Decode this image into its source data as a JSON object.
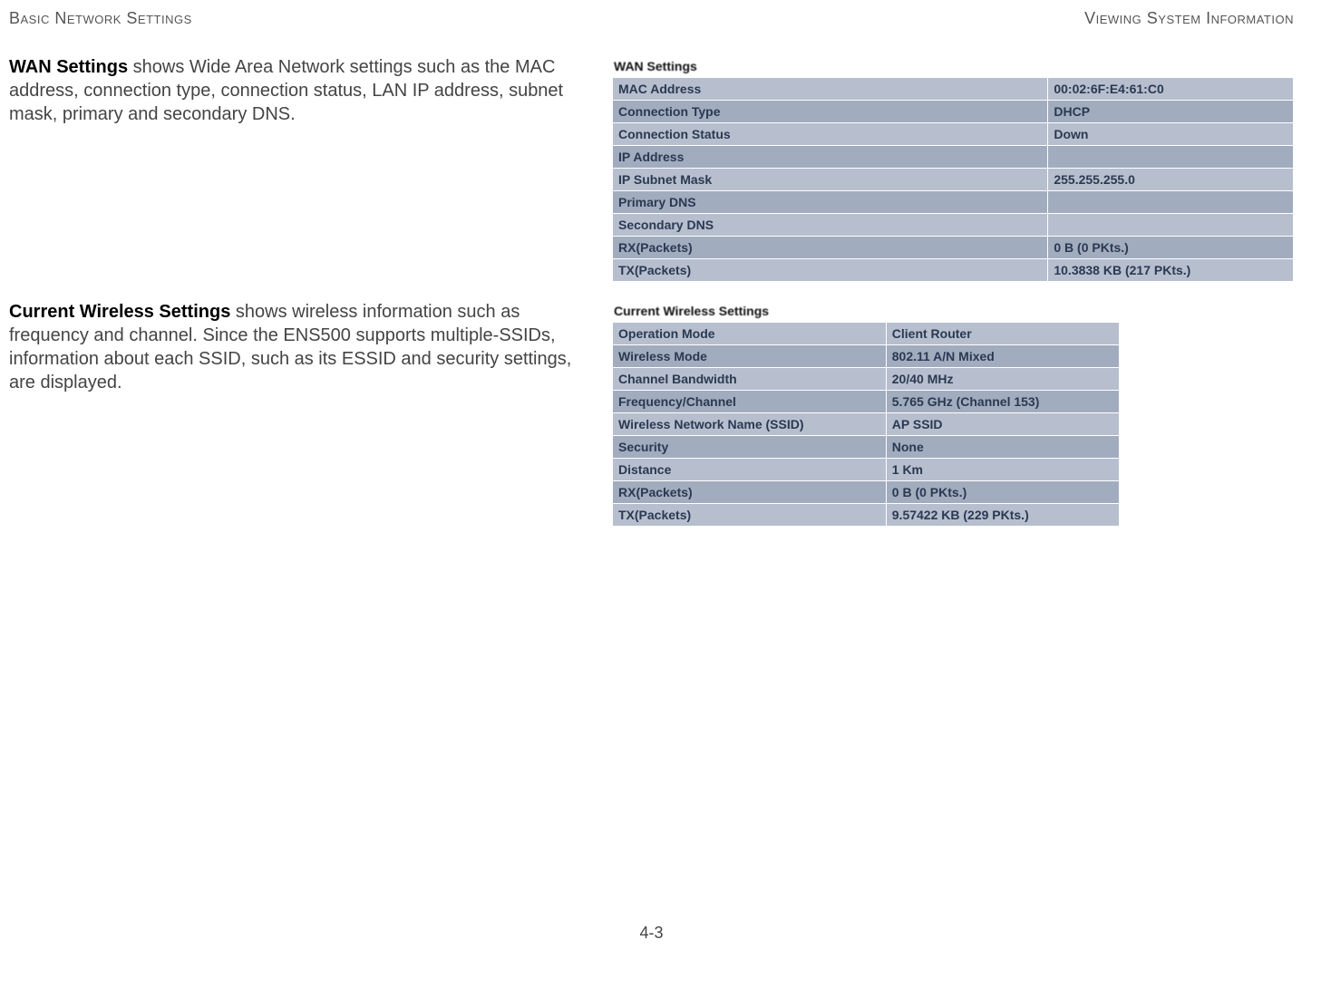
{
  "header": {
    "left": "Basic Network Settings",
    "right": "Viewing System Information"
  },
  "sections": {
    "wan": {
      "heading": "WAN Settings",
      "body": "  shows Wide Area Network settings such as the MAC address, connection type, connection status, LAN IP address, subnet mask, primary and secondary DNS.",
      "panel_title": "WAN Settings",
      "rows": [
        {
          "label": "MAC Address",
          "value": "00:02:6F:E4:61:C0"
        },
        {
          "label": "Connection Type",
          "value": "DHCP"
        },
        {
          "label": "Connection Status",
          "value": "Down"
        },
        {
          "label": "IP Address",
          "value": ""
        },
        {
          "label": "IP Subnet Mask",
          "value": "255.255.255.0"
        },
        {
          "label": "Primary DNS",
          "value": ""
        },
        {
          "label": "Secondary DNS",
          "value": ""
        },
        {
          "label": "RX(Packets)",
          "value": "0 B (0 PKts.)"
        },
        {
          "label": "TX(Packets)",
          "value": "10.3838 KB (217 PKts.)"
        }
      ]
    },
    "wireless": {
      "heading": "Current Wireless Settings",
      "body": "  shows wireless information such as frequency and channel. Since the ENS500 supports multiple-SSIDs, information about each SSID, such as its ESSID and security settings, are displayed.",
      "panel_title": "Current Wireless Settings",
      "rows": [
        {
          "label": "Operation Mode",
          "value": "Client Router"
        },
        {
          "label": "Wireless Mode",
          "value": "802.11 A/N Mixed"
        },
        {
          "label": "Channel Bandwidth",
          "value": "20/40 MHz"
        },
        {
          "label": "Frequency/Channel",
          "value": "5.765 GHz (Channel 153)"
        },
        {
          "label": "Wireless Network Name (SSID)",
          "value": "AP SSID"
        },
        {
          "label": "Security",
          "value": "None"
        },
        {
          "label": "Distance",
          "value": "1 Km"
        },
        {
          "label": "RX(Packets)",
          "value": "0 B (0 PKts.)"
        },
        {
          "label": "TX(Packets)",
          "value": "9.57422 KB (229 PKts.)"
        }
      ]
    }
  },
  "footer": {
    "page_number": "4-3"
  }
}
